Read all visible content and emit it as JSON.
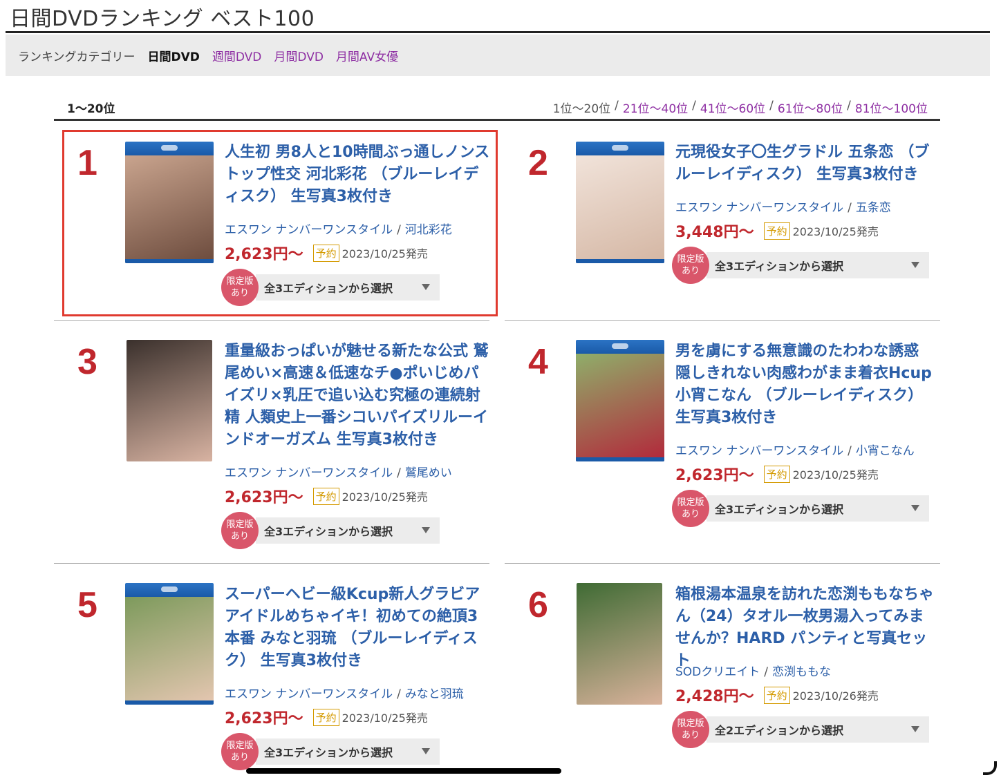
{
  "page_title": "日間DVDランキング ベスト100",
  "category_bar": {
    "label": "ランキングカテゴリー",
    "current": "日間DVD",
    "links": [
      "週間DVD",
      "月間DVD",
      "月間AV女優"
    ]
  },
  "range": {
    "current": "1〜20位",
    "nav": {
      "current": "1位〜20位",
      "links": [
        "21位〜40位",
        "41位〜60位",
        "61位〜80位",
        "81位〜100位"
      ]
    }
  },
  "colors": {
    "rank_red": "#c0272d",
    "link_blue": "#2c5fa8",
    "category_purple": "#8e2fa3",
    "limited_pink": "#d9566a",
    "reservation_orange": "#d49a00",
    "highlight_red": "#e03a2f"
  },
  "items": [
    {
      "rank": "1",
      "title": "人生初 男8人と10時間ぶっ通しノンストップ性交 河北彩花 （ブルーレイディスク） 生写真3枚付き",
      "label": "エスワン ナンバーワンスタイル",
      "actress": "河北彩花",
      "price": "2,623円〜",
      "reservation": "予約",
      "release": "2023/10/25発売",
      "limited_line1": "限定版",
      "limited_line2": "あり",
      "edition_select": "全3エディションから選択",
      "thumb_colors": [
        "#c9a48e",
        "#6b4a3c"
      ]
    },
    {
      "rank": "2",
      "title": "元現役女子〇生グラドル 五条恋 （ブルーレイディスク） 生写真3枚付き",
      "label": "エスワン ナンバーワンスタイル",
      "actress": "五条恋",
      "price": "3,448円〜",
      "reservation": "予約",
      "release": "2023/10/25発売",
      "limited_line1": "限定版",
      "limited_line2": "あり",
      "edition_select": "全3エディションから選択",
      "thumb_colors": [
        "#f1e3da",
        "#d4b6a3"
      ]
    },
    {
      "rank": "3",
      "title": "重量級おっぱいが魅せる新たな公式 鷲尾めい×高速＆低速なチ●ポいじめパイズリ×乳圧で追い込む究極の連続射精 人類史上一番シコいパイズリルーインドオーガズム 生写真3枚付き",
      "label": "エスワン ナンバーワンスタイル",
      "actress": "鷲尾めい",
      "price": "2,623円〜",
      "reservation": "予約",
      "release": "2023/10/25発売",
      "limited_line1": "限定版",
      "limited_line2": "あり",
      "edition_select": "全3エディションから選択",
      "thumb_colors": [
        "#3a302c",
        "#d8b3a2"
      ]
    },
    {
      "rank": "4",
      "title": "男を虜にする無意識のたわわな誘惑 隠しきれない肉感わがまま着衣Hcup 小宵こなん （ブルーレイディスク） 生写真3枚付き",
      "label": "エスワン ナンバーワンスタイル",
      "actress": "小宵こなん",
      "price": "2,623円〜",
      "reservation": "予約",
      "release": "2023/10/25発売",
      "limited_line1": "限定版",
      "limited_line2": "あり",
      "edition_select": "全3エディションから選択",
      "thumb_colors": [
        "#8fae6a",
        "#b3263a"
      ]
    },
    {
      "rank": "5",
      "title": "スーパーヘビー級Kcup新人グラビアアイドルめちゃイキ！初めての絶頂3本番 みなと羽琉 （ブルーレイディスク） 生写真3枚付き",
      "label": "エスワン ナンバーワンスタイル",
      "actress": "みなと羽琉",
      "price": "2,623円〜",
      "reservation": "予約",
      "release": "2023/10/25発売",
      "limited_line1": "限定版",
      "limited_line2": "あり",
      "edition_select": "全3エディションから選択",
      "thumb_colors": [
        "#7d9a5c",
        "#e6c7b2"
      ]
    },
    {
      "rank": "6",
      "title": "箱根湯本温泉を訪れた恋渕ももなちゃん（24）タオル一枚男湯入ってみませんか？HARD パンティと写真セット",
      "label": "SODクリエイト",
      "actress": "恋渕ももな",
      "price": "2,428円〜",
      "reservation": "予約",
      "release": "2023/10/26発売",
      "limited_line1": "限定版",
      "limited_line2": "あり",
      "edition_select": "全2エディションから選択",
      "thumb_colors": [
        "#3f6b34",
        "#d9b29b"
      ]
    }
  ]
}
